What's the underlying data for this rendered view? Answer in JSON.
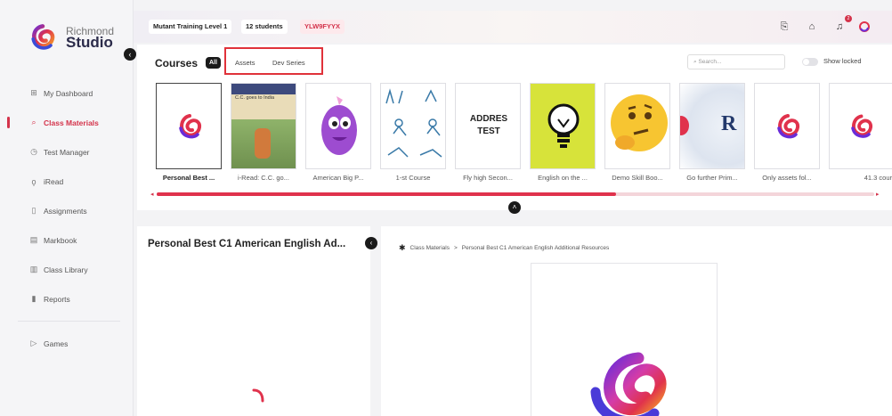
{
  "app": {
    "logo_line1": "Richmond",
    "logo_line2": "Studio"
  },
  "sidebar": {
    "items": [
      {
        "label": "My Dashboard",
        "icon": "grid-icon",
        "active": false
      },
      {
        "label": "Class Materials",
        "icon": "search-icon",
        "active": true
      },
      {
        "label": "Test Manager",
        "icon": "clock-icon",
        "active": false
      },
      {
        "label": "iRead",
        "icon": "read-icon",
        "active": false
      },
      {
        "label": "Assignments",
        "icon": "assignment-icon",
        "active": false
      },
      {
        "label": "Markbook",
        "icon": "markbook-icon",
        "active": false
      },
      {
        "label": "Class Library",
        "icon": "library-icon",
        "active": false
      },
      {
        "label": "Reports",
        "icon": "reports-icon",
        "active": false
      },
      {
        "label": "Games",
        "icon": "play-icon",
        "active": false
      }
    ]
  },
  "topbar": {
    "class_name": "Mutant Training Level 1",
    "students": "12 students",
    "class_code": "YLW9FYYX",
    "notification_count": "2"
  },
  "courses": {
    "title": "Courses",
    "all_label": "All",
    "tabs": [
      "Assets",
      "Dev Series"
    ],
    "search_placeholder": "Search...",
    "show_locked_label": "Show locked",
    "cards": [
      {
        "title": "Personal Best ...",
        "thumb": "richmond-logo",
        "selected": true
      },
      {
        "title": "i-Read: C.C. go...",
        "thumb": "book-cover",
        "cover_text": "C.C. goes to India",
        "selected": false
      },
      {
        "title": "American Big P...",
        "thumb": "purple-monster",
        "selected": false
      },
      {
        "title": "1-st Course",
        "thumb": "sketch-figures",
        "selected": false
      },
      {
        "title": "Fly high Secon...",
        "thumb": "text",
        "thumb_text_1": "ADDRES",
        "thumb_text_2": "TEST",
        "selected": false
      },
      {
        "title": "English on the ...",
        "thumb": "lightbulb",
        "selected": false
      },
      {
        "title": "Demo Skill Boo...",
        "thumb": "thinking-emoji",
        "selected": false
      },
      {
        "title": "Go further Prim...",
        "thumb": "r-letter",
        "thumb_text_1": "R",
        "selected": false
      },
      {
        "title": "Only assets fol...",
        "thumb": "richmond-logo",
        "selected": false
      },
      {
        "title": "41.3 cour",
        "thumb": "richmond-logo",
        "selected": false
      }
    ],
    "scroll_fraction": 0.64
  },
  "detail": {
    "title": "Personal Best C1 American English Ad...",
    "breadcrumb": [
      "Class Materials",
      ">",
      "Personal Best C1 American English Additional Resources"
    ]
  },
  "colors": {
    "accent": "#d4334b",
    "scroll_track": "#f4d5da"
  }
}
